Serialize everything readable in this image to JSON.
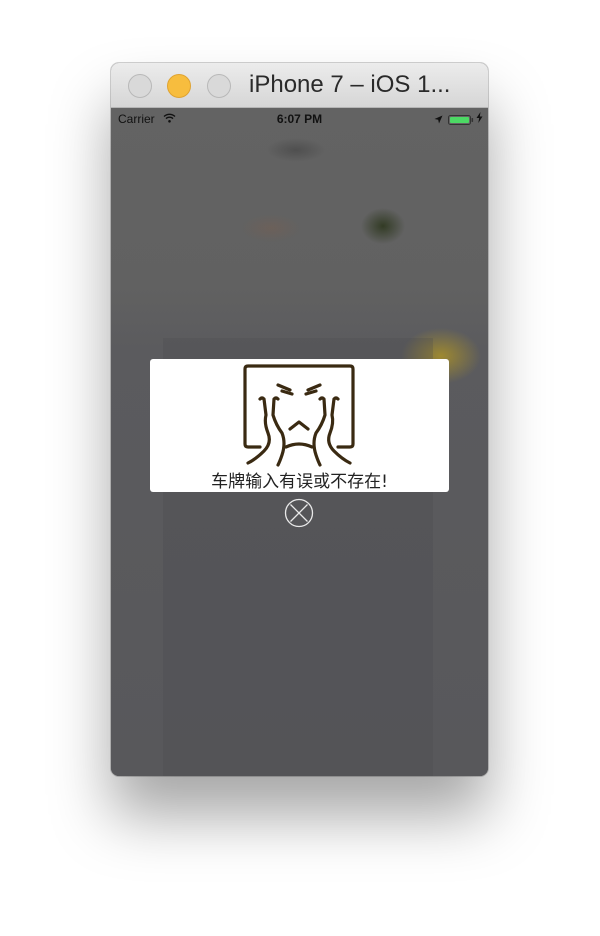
{
  "window": {
    "title": "iPhone 7 – iOS 1..."
  },
  "status_bar": {
    "carrier": "Carrier",
    "time": "6:07 PM"
  },
  "alert": {
    "message": "车牌输入有误或不存在!",
    "icon": "crying-face-icon"
  },
  "colors": {
    "minimize": "#f7bd3e",
    "battery": "#4cd964",
    "icon_stroke": "#3a2a12",
    "overlay": "#5b5b5e"
  }
}
